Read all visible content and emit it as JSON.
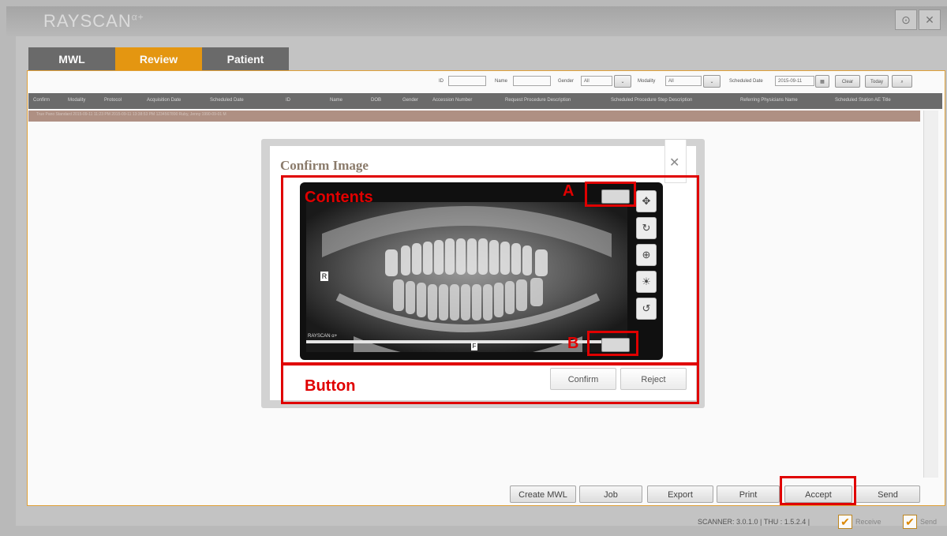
{
  "app": {
    "logo": "RAYSCAN",
    "logo_sup": "α+"
  },
  "window": {
    "settings_glyph": "⊙",
    "close_glyph": "✕"
  },
  "tabs": [
    {
      "label": "MWL"
    },
    {
      "label": "Review"
    },
    {
      "label": "Patient"
    }
  ],
  "filters": {
    "id_label": "ID",
    "name_label": "Name",
    "gender_label": "Gender",
    "gender_value": "All",
    "modality_label": "Modality",
    "modality_value": "All",
    "scheduled_date_label": "Scheduled Date",
    "scheduled_date_value": "2015-09-11",
    "clear_label": "Clear",
    "today_label": "Today",
    "search_glyph": "🔍"
  },
  "table": {
    "columns": [
      "Confirm",
      "Modality",
      "Protocol",
      "Acquisition Date",
      "Scheduled Date",
      "ID",
      "Name",
      "DOB",
      "Gender",
      "Accession Number",
      "Request Procedure Description",
      "Scheduled Procedure Step Description",
      "Referring Physicians Name",
      "Scheduled Station AE Title"
    ],
    "row_text": "True     Pano      Standard      2015-09-11 11:23 PM      2015-09-11 13:38:53 PM      1234567890      Ruby, Jenny      1990-09-01      M"
  },
  "bottom_buttons": {
    "create_mwl": "Create MWL",
    "job": "Job",
    "export": "Export",
    "print": "Print",
    "accept": "Accept",
    "send": "Send"
  },
  "status": {
    "scanner_text": "SCANNER: 3.0.1.0 | THU : 1.5.2.4 |",
    "receive_label": "Receive",
    "send_label": "Send",
    "check_glyph": "✔"
  },
  "dialog": {
    "title": "Confirm Image",
    "close_glyph": "✕",
    "confirm_label": "Confirm",
    "reject_label": "Reject",
    "image_marker_r": "R",
    "image_marker_f": "F",
    "image_watermark": "RAYSCAN α+",
    "tools": [
      {
        "icon": "move-icon",
        "glyph": "✥"
      },
      {
        "icon": "rotate-icon",
        "glyph": "↻"
      },
      {
        "icon": "zoom-icon",
        "glyph": "⊕"
      },
      {
        "icon": "brightness-icon",
        "glyph": "☀"
      },
      {
        "icon": "reset-icon",
        "glyph": "↺"
      }
    ]
  },
  "annotations": {
    "contents_label": "Contents",
    "button_label": "Button",
    "marker_a": "A",
    "marker_b": "B",
    "color": "#e00000"
  },
  "colors": {
    "accent_tab": "#e99a12",
    "inactive_tab": "#6d6d6d",
    "table_header": "#6e6e6e"
  }
}
